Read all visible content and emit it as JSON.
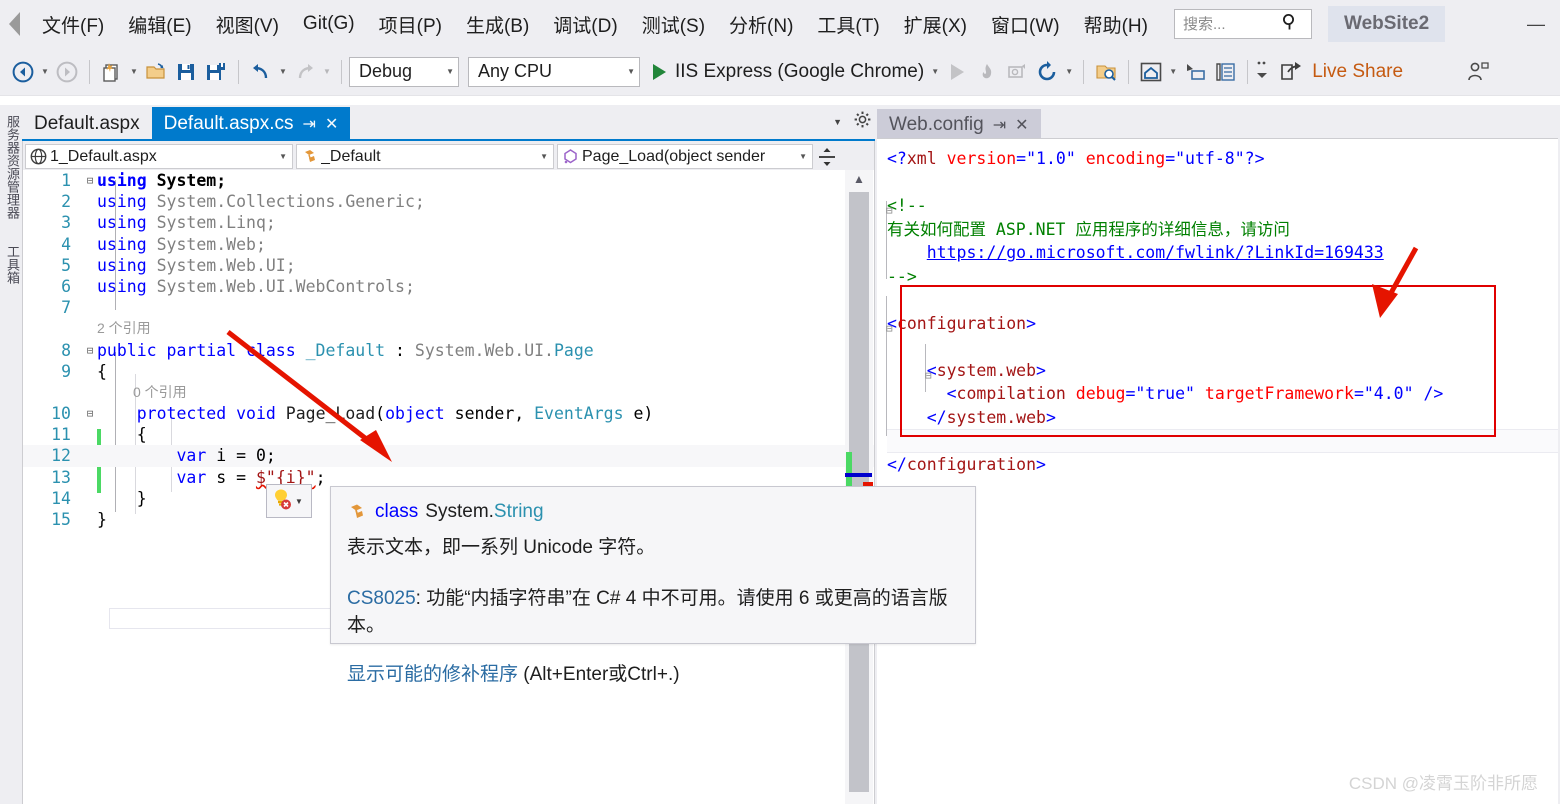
{
  "menu": {
    "back_icon": "back-chevron-icon",
    "items": [
      "文件(F)",
      "编辑(E)",
      "视图(V)",
      "Git(G)",
      "项目(P)",
      "生成(B)",
      "调试(D)",
      "测试(S)",
      "分析(N)",
      "工具(T)",
      "扩展(X)",
      "窗口(W)",
      "帮助(H)"
    ],
    "search": {
      "placeholder": "搜索...",
      "value": "",
      "icon": "search-icon"
    },
    "solution_name": "WebSite2",
    "minimize_label": "—"
  },
  "toolbar": {
    "nav_back_icon": "navigate-back-icon",
    "nav_forward_icon": "navigate-forward-icon",
    "new_item_icon": "new-item-icon",
    "open_icon": "open-folder-icon",
    "save_icon": "save-icon",
    "save_all_icon": "save-all-icon",
    "undo_icon": "undo-icon",
    "redo_icon": "redo-icon",
    "config_combo": {
      "value": "Debug"
    },
    "platform_combo": {
      "value": "Any CPU"
    },
    "run_label": "IIS Express (Google Chrome)",
    "run_icon": "play-icon",
    "start_dim_icon": "play-dim-icon",
    "hot_reload_icon": "hot-reload-icon",
    "attach_icon": "attach-process-icon",
    "refresh_icon": "refresh-icon",
    "find_icon": "find-in-files-icon",
    "home_icon": "start-page-icon",
    "window_icon": "window-layout-icon",
    "solution_icon": "solution-explorer-icon",
    "more_icon": "overflow-icon",
    "live_share_label": "Live Share",
    "live_share_icon": "share-icon",
    "account_icon": "account-icon"
  },
  "left_dock": {
    "items": [
      "服务器资源管理器",
      "工具箱"
    ]
  },
  "tabs": {
    "left": [
      {
        "label": "Default.aspx",
        "active": false
      },
      {
        "label": "Default.aspx.cs",
        "active": true,
        "pin": "⇥",
        "close": "✕"
      }
    ],
    "right": [
      {
        "label": "Web.config",
        "active": false,
        "pin": "⇥",
        "close": "✕"
      }
    ],
    "overflow_caret": "▼",
    "gear_icon": "gear-icon"
  },
  "nav_bar": {
    "file_combo": {
      "value": "1_Default.aspx",
      "icon": "globe-icon"
    },
    "class_combo": {
      "value": "_Default",
      "icon": "class-icon"
    },
    "member_combo": {
      "value": "Page_Load(object sender",
      "icon": "method-icon"
    },
    "split_icon": "split-window-icon"
  },
  "code": {
    "lines": [
      {
        "n": "1",
        "text": "using System;",
        "fold": "⊟"
      },
      {
        "n": "2",
        "text": "using System.Collections.Generic;",
        "fold": ""
      },
      {
        "n": "3",
        "text": "using System.Linq;",
        "fold": ""
      },
      {
        "n": "4",
        "text": "using System.Web;",
        "fold": ""
      },
      {
        "n": "5",
        "text": "using System.Web.UI;",
        "fold": ""
      },
      {
        "n": "6",
        "text": "using System.Web.UI.WebControls;",
        "fold": ""
      },
      {
        "n": "7",
        "text": "",
        "fold": ""
      },
      {
        "n": "8",
        "text": "public partial class _Default : System.Web.UI.Page",
        "fold": "⊟"
      },
      {
        "n": "9",
        "text": "{",
        "fold": ""
      },
      {
        "n": "10",
        "text": "    protected void Page_Load(object sender, EventArgs e)",
        "fold": "⊟"
      },
      {
        "n": "11",
        "text": "    {",
        "fold": ""
      },
      {
        "n": "12",
        "text": "        var i = 0;",
        "fold": ""
      },
      {
        "n": "13",
        "text": "        var s = $\"{i}\";",
        "fold": ""
      },
      {
        "n": "14",
        "text": "    }",
        "fold": ""
      },
      {
        "n": "15",
        "text": "}",
        "fold": ""
      }
    ],
    "codelens": [
      {
        "after_line": "7",
        "text": "2 个引用"
      },
      {
        "after_line": "9",
        "text": "0 个引用"
      }
    ]
  },
  "quickactions": {
    "bulb_icon": "lightbulb-error-icon",
    "caret": "▼"
  },
  "tooltip": {
    "kind": "class",
    "type_namespace": "System.",
    "type_name": "String",
    "icon": "class-icon",
    "description": "表示文本，即一系列 Unicode 字符。",
    "diagnostic_code": "CS8025",
    "diagnostic_text": ": 功能“内插字符串”在 C# 4 中不可用。请使用 6 或更高的语言版本。",
    "fix_link": "显示可能的修补程序",
    "fix_shortcut": " (Alt+Enter或Ctrl+.)"
  },
  "webconfig": {
    "lines": [
      "<?xml version=\"1.0\" encoding=\"utf-8\"?>",
      "",
      "<!--",
      "    有关如何配置 ASP.NET 应用程序的详细信息，请访问",
      "    https://go.microsoft.com/fwlink/?LinkId=169433",
      "-->",
      "",
      "<configuration>",
      "",
      "    <system.web>",
      "      <compilation debug=\"true\" targetFramework=\"4.0\" />",
      "    </system.web>",
      "",
      "</configuration>"
    ],
    "link": "https://go.microsoft.com/fwlink/?LinkId=169433",
    "comment_text": "有关如何配置 ASP.NET 应用程序的详细信息，请访问"
  },
  "scrollbar": {
    "up_arrow": "▲",
    "marker_change_color": "#4bd964",
    "marker_caret_color": "#0000cd",
    "marker_error_color": "#e51400"
  },
  "annotations": {
    "rect_color": "#e00000",
    "arrow_color": "#e51400",
    "arrow_count": 2
  },
  "watermark": "CSDN @凌霄玉阶非所愿",
  "colors": {
    "chrome": "#eeeef2",
    "accent": "#007acc",
    "keyword": "#0000ff",
    "type": "#2b91af",
    "string": "#a31515",
    "namespace": "#808080",
    "xml_attr": "#ff0000",
    "xml_comment": "#008000",
    "live_share": "#c55a11",
    "error": "#e51400"
  }
}
